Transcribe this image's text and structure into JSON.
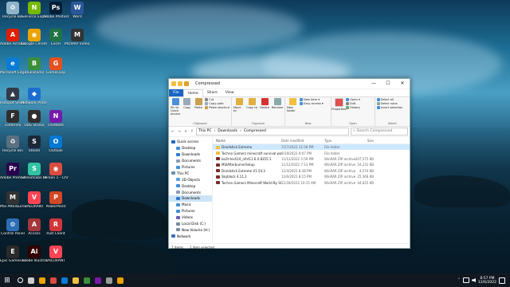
{
  "desktop_icons": [
    {
      "label": "Recycle Bin",
      "color": "#8fb3c8",
      "glyph": "♻"
    },
    {
      "label": "GeForce Experience",
      "color": "#76b900",
      "glyph": "N"
    },
    {
      "label": "Adobe Photosh...",
      "color": "#001e36",
      "glyph": "Ps"
    },
    {
      "label": "Word",
      "color": "#2b579a",
      "glyph": "W"
    },
    {
      "label": "Adobe Acrobat DC",
      "color": "#e01e00",
      "glyph": "A"
    },
    {
      "label": "Google Chrome",
      "color": "#eaa300",
      "glyph": "◉"
    },
    {
      "label": "Excel",
      "color": "#217346",
      "glyph": "X"
    },
    {
      "label": "MOVAVI Video...",
      "color": "#333333",
      "glyph": "M"
    },
    {
      "label": "Microsoft Edge",
      "color": "#0a7bd6",
      "glyph": "e"
    },
    {
      "label": "BlueStacks",
      "color": "#3a8f3a",
      "glyph": "B"
    },
    {
      "label": "GameLoop",
      "color": "#e6501e",
      "glyph": "G"
    },
    {
      "label": "Hotspot Shield",
      "color": "#333b4a",
      "glyph": "▲"
    },
    {
      "label": "Network Protect...",
      "color": "#1b6ecf",
      "glyph": "◆"
    },
    {
      "label": "Folderino",
      "color": "#2e2e2e",
      "glyph": "F"
    },
    {
      "label": "OBS Studio",
      "color": "#302e31",
      "glyph": "●"
    },
    {
      "label": "OneNote",
      "color": "#7719aa",
      "glyph": "N"
    },
    {
      "label": "Recycle Bin",
      "color": "#5a7080",
      "glyph": "♻"
    },
    {
      "label": "Steam",
      "color": "#1b2838",
      "glyph": "S"
    },
    {
      "label": "Outlook",
      "color": "#0078d4",
      "glyph": "O"
    },
    {
      "label": "Adobe Premiere P...",
      "color": "#2a004e",
      "glyph": "Pr"
    },
    {
      "label": "Streamlabs Desktop",
      "color": "#31c3a2",
      "glyph": "S"
    },
    {
      "label": "Person 1 - Chrome",
      "color": "#d94c3d",
      "glyph": "◉"
    },
    {
      "label": "MSI Afterburner",
      "color": "#333333",
      "glyph": "M"
    },
    {
      "label": "VALORANT",
      "color": "#fa4454",
      "glyph": "V"
    },
    {
      "label": "PowerPoint",
      "color": "#d24726",
      "glyph": "P"
    },
    {
      "label": "Control Panel",
      "color": "#2d6db5",
      "glyph": "⚙"
    },
    {
      "label": "Access",
      "color": "#a4373a",
      "glyph": "A"
    },
    {
      "label": "Riot Client",
      "color": "#d13639",
      "glyph": "R"
    },
    {
      "label": "Epic Games Launcher",
      "color": "#2a2a2a",
      "glyph": "E"
    },
    {
      "label": "Adobe Illustrat...",
      "color": "#330000",
      "glyph": "Ai"
    },
    {
      "label": "VALORANT",
      "color": "#fa4454",
      "glyph": "V"
    }
  ],
  "window": {
    "title": "Compressed",
    "minimize": "—",
    "maximize": "☐",
    "close": "✕",
    "tabs": [
      "File",
      "Home",
      "Share",
      "View"
    ],
    "ribbon": {
      "clipboard": {
        "label": "Clipboard",
        "pin": "Pin to Quick access",
        "copy": "Copy",
        "paste": "Paste",
        "cut": "Cut",
        "copy_path": "Copy path",
        "paste_shortcut": "Paste shortcut"
      },
      "organize": {
        "label": "Organize",
        "move_to": "Move to",
        "copy_to": "Copy to",
        "delete": "Delete",
        "rename": "Rename"
      },
      "new": {
        "label": "New",
        "new_folder": "New folder",
        "new_item": "New item ▾",
        "easy_access": "Easy access ▾"
      },
      "open": {
        "label": "Open",
        "properties": "Properties",
        "open": "Open ▾",
        "edit": "Edit",
        "history": "History"
      },
      "select": {
        "label": "Select",
        "select_all": "Select all",
        "select_none": "Select none",
        "invert": "Invert selection"
      }
    },
    "address": {
      "back": "←",
      "forward": "→",
      "up_list": "∨",
      "up": "↑",
      "crumbs": [
        "This PC",
        "Downloads",
        "Compressed"
      ],
      "search_placeholder": "Search Compressed",
      "search_icon": "⌕"
    },
    "nav_pane": [
      {
        "label": "Quick access",
        "indent": false,
        "color": "#1a66c4",
        "selected": false
      },
      {
        "label": "Desktop",
        "indent": true,
        "color": "#3f8fd8",
        "selected": false
      },
      {
        "label": "Downloads",
        "indent": true,
        "color": "#2f7bd0",
        "selected": false
      },
      {
        "label": "Documents",
        "indent": true,
        "color": "#8b9bb0",
        "selected": false
      },
      {
        "label": "Pictures",
        "indent": true,
        "color": "#3f8fd8",
        "selected": false
      },
      {
        "label": "This PC",
        "indent": false,
        "color": "#6a8fb0",
        "selected": false
      },
      {
        "label": "3D Objects",
        "indent": true,
        "color": "#5aa0e0",
        "selected": false
      },
      {
        "label": "Desktop",
        "indent": true,
        "color": "#3f8fd8",
        "selected": false
      },
      {
        "label": "Documents",
        "indent": true,
        "color": "#8b9bb0",
        "selected": false
      },
      {
        "label": "Downloads",
        "indent": true,
        "color": "#2f7bd0",
        "selected": true
      },
      {
        "label": "Music",
        "indent": true,
        "color": "#3f8fd8",
        "selected": false
      },
      {
        "label": "Pictures",
        "indent": true,
        "color": "#3f8fd8",
        "selected": false
      },
      {
        "label": "Videos",
        "indent": true,
        "color": "#6b5bb8",
        "selected": false
      },
      {
        "label": "Local Disk (C:)",
        "indent": true,
        "color": "#7a8a99",
        "selected": false
      },
      {
        "label": "New Volume (H:)",
        "indent": true,
        "color": "#7a8a99",
        "selected": false
      },
      {
        "label": "Network",
        "indent": false,
        "color": "#3a6fb0",
        "selected": false
      }
    ],
    "columns": [
      "Name",
      "Date modified",
      "Type",
      "Size"
    ],
    "files": [
      {
        "name": "Droidstick Extreme",
        "date": "7/27/2022 11:58 PM",
        "type": "File folder",
        "size": "",
        "color": "#f0c040",
        "selected": true
      },
      {
        "name": "Techno Gamerz minecraft survival world ...",
        "date": "9/18/2022 9:07 PM",
        "type": "File folder",
        "size": "",
        "color": "#f0c040",
        "selected": false
      },
      {
        "name": "bo2t-tech10_nfnt11.6.0.8355.1",
        "date": "11/12/2022 5:59 PM",
        "type": "WinRAR ZIP archive",
        "size": "207,575 KB",
        "color": "#7b2c2c",
        "selected": false
      },
      {
        "name": "MSIAfterburnerSetup",
        "date": "11/12/2022 7:13 PM",
        "type": "WinRAR ZIP archive",
        "size": "54,231 KB",
        "color": "#7b2c2c",
        "selected": false
      },
      {
        "name": "Droidstick Extreme V1.54.3",
        "date": "12/4/2022 8:38 PM",
        "type": "WinRAR ZIP archive",
        "size": "4,574 KB",
        "color": "#7b2c2c",
        "selected": false
      },
      {
        "name": "Skyblock 4.11.2",
        "date": "12/6/2022 8:15 PM",
        "type": "WinRAR ZIP archive",
        "size": "25,366 KB",
        "color": "#7b2c2c",
        "selected": false
      },
      {
        "name": "Techno Gamerz Minecraft World By SHA...",
        "date": "11/28/2022 10:15 AM",
        "type": "WinRAR ZIP archive",
        "size": "44,625 KB",
        "color": "#7b2c2c",
        "selected": false
      }
    ],
    "status": {
      "items": "7 items",
      "selected": "1 item selected"
    }
  },
  "taskbar": {
    "start_glyph": "⊞",
    "apps": [
      {
        "name": "search",
        "color": "#ffffff"
      },
      {
        "name": "task-view",
        "color": "#cccccc"
      },
      {
        "name": "chrome",
        "color": "#eaa300"
      },
      {
        "name": "chrome-2",
        "color": "#d94c3d"
      },
      {
        "name": "edge",
        "color": "#0a7bd6"
      },
      {
        "name": "file-explorer",
        "color": "#f0c040"
      },
      {
        "name": "app-green",
        "color": "#3a8f3a"
      },
      {
        "name": "app-purple",
        "color": "#7719aa"
      },
      {
        "name": "obs",
        "color": "#9a9a9a"
      },
      {
        "name": "chrome-3",
        "color": "#eaa300"
      }
    ],
    "tray_arrow": "⌃",
    "time": "8:57 PM",
    "date": "12/6/2022"
  }
}
